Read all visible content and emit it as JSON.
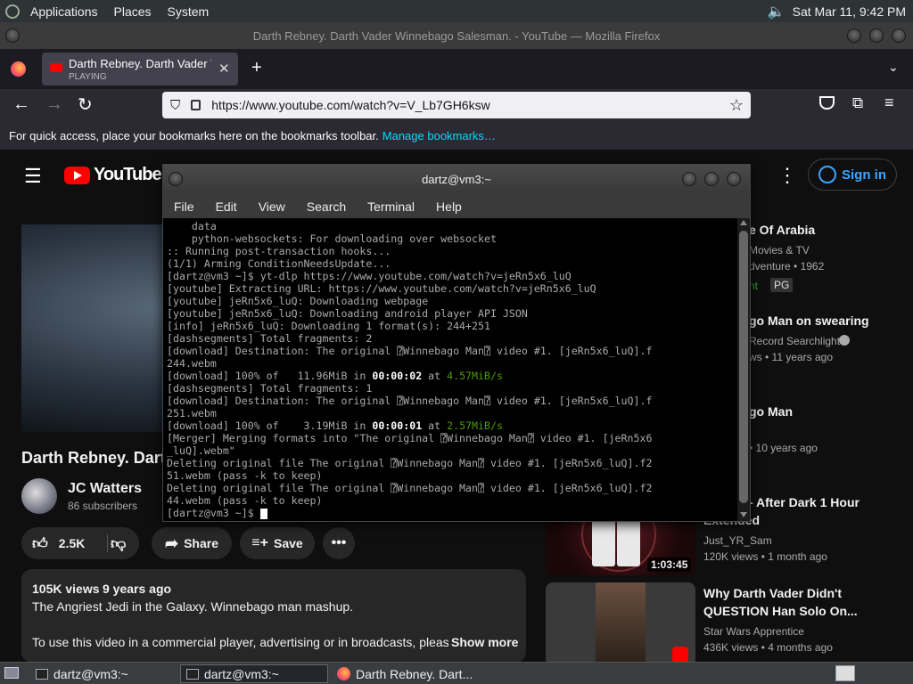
{
  "system_bar": {
    "menus": [
      "Applications",
      "Places",
      "System"
    ],
    "datetime": "Sat Mar 11,  9:42 PM"
  },
  "window_title": "Darth Rebney. Darth Vader Winnebago Salesman. - YouTube — Mozilla Firefox",
  "tab": {
    "title": "Darth Rebney. Darth Vader W",
    "status": "PLAYING"
  },
  "url": "https://www.youtube.com/watch?v=V_Lb7GH6ksw",
  "bookmarks_bar": {
    "text": "For quick access, place your bookmarks here on the bookmarks toolbar.",
    "link": "Manage bookmarks…"
  },
  "youtube": {
    "logo": "YouTube",
    "signin": "Sign in",
    "video_title": "Darth Rebney. Dart",
    "channel": "JC Watters",
    "subscribers": "86 subscribers",
    "likes": "2.5K",
    "share": "Share",
    "save": "Save",
    "views": "105K views",
    "age": "9 years ago",
    "desc1": "The Angriest Jedi in the Galaxy.  Winnebago man mashup.",
    "desc2": "To use this video in a commercial player, advertising or in broadcasts, pleas",
    "show_more": "Show more",
    "related": [
      {
        "t1": "e Of Arabia",
        "s1": "Movies & TV",
        "s2": "dventure • 1962",
        "badge1": "nt",
        "badge2": "PG"
      },
      {
        "t1": "go Man on swearing",
        "s1": "Record Searchlight",
        "s2": "ws • 11 years ago"
      },
      {
        "t1": "go Man",
        "s1": "",
        "s2": "• 10 years ago"
      },
      {
        "t1": "- After Dark 1 Hour",
        "t2": "Extended",
        "s1": "Just_YR_Sam",
        "s2": "120K views • 1 month ago",
        "duration": "1:03:45"
      },
      {
        "t1": "Why Darth Vader Didn't",
        "t2": "QUESTION Han Solo On...",
        "s1": "Star Wars Apprentice",
        "s2": "436K views • 4 months ago"
      }
    ]
  },
  "terminal": {
    "title": "dartz@vm3:~",
    "menu": [
      "File",
      "Edit",
      "View",
      "Search",
      "Terminal",
      "Help"
    ],
    "lines": [
      "    data",
      "    python-websockets: For downloading over websocket",
      ":: Running post-transaction hooks...",
      "(1/1) Arming ConditionNeedsUpdate...",
      "[dartz@vm3 ~]$ yt-dlp https://www.youtube.com/watch?v=jeRn5x6_luQ",
      "[youtube] Extracting URL: https://www.youtube.com/watch?v=jeRn5x6_luQ",
      "[youtube] jeRn5x6_luQ: Downloading webpage",
      "[youtube] jeRn5x6_luQ: Downloading android player API JSON",
      "[info] jeRn5x6_luQ: Downloading 1 format(s): 244+251",
      "[dashsegments] Total fragments: 2",
      "[download] Destination: The original ⍰Winnebago Man⍰ video #1. [jeRn5x6_luQ].f",
      "244.webm",
      "[download] 100% of   11.96MiB in 00:00:02 at 4.57MiB/s",
      "[dashsegments] Total fragments: 1",
      "[download] Destination: The original ⍰Winnebago Man⍰ video #1. [jeRn5x6_luQ].f",
      "251.webm",
      "[download] 100% of    3.19MiB in 00:00:01 at 2.57MiB/s",
      "[Merger] Merging formats into \"The original ⍰Winnebago Man⍰ video #1. [jeRn5x6",
      "_luQ].webm\"",
      "Deleting original file The original ⍰Winnebago Man⍰ video #1. [jeRn5x6_luQ].f2",
      "51.webm (pass -k to keep)",
      "Deleting original file The original ⍰Winnebago Man⍰ video #1. [jeRn5x6_luQ].f2",
      "44.webm (pass -k to keep)",
      "[dartz@vm3 ~]$ "
    ]
  },
  "taskbar": {
    "items": [
      "dartz@vm3:~",
      "dartz@vm3:~",
      "Darth Rebney. Dart..."
    ]
  }
}
